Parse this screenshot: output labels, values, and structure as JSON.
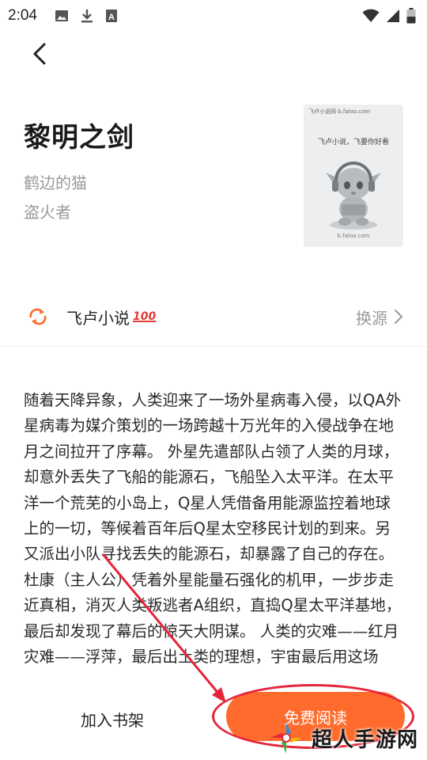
{
  "status_bar": {
    "time": "2:04",
    "icons_left": [
      "image-icon",
      "download-icon",
      "a-box-icon"
    ],
    "icons_right": [
      "wifi-icon",
      "signal-icon",
      "battery-icon"
    ]
  },
  "header": {
    "back_icon": "chevron-left-icon"
  },
  "book": {
    "title": "黎明之剑",
    "author": "鹤边的猫",
    "narrator": "盗火者",
    "cover": {
      "logo": "飞卢小说网 b.faloo.com",
      "tagline": "飞卢小说，飞要你好看",
      "url": "b.faloo.com"
    }
  },
  "source": {
    "icon": "refresh-arrows-icon",
    "name": "飞卢小说",
    "badge": "100",
    "switch_label": "换源",
    "switch_icon": "chevron-right-icon",
    "accent_color": "#ff6b2c"
  },
  "synopsis": "随着天降异象，人类迎来了一场外星病毒入侵，以QA外星病毒为媒介策划的一场跨越十万光年的入侵战争在地月之间拉开了序幕。 外星先遣部队占领了人类的月球，却意外丢失了飞船的能源石，飞船坠入太平洋。在太平洋一个荒芜的小岛上，Q星人凭借备用能源监控着地球上的一切，等候着百年后Q星太空移民计划的到来。另又派出小队寻找丢失的能源石，却暴露了自己的存在。杜康（主人公）凭着外星能量石强化的机甲，一步步走近真相，消灭人类叛逃者A组织，直捣Q星太平洋基地，最后却发现了幕后的惊天大阴谋。 人类的灾难——红月灾难——浮萍，最后出土类的理想，宇宙最后用这场",
  "bottom": {
    "add_shelf_label": "加入书架",
    "read_label": "免费阅读",
    "read_color": "#ff6b2c"
  },
  "annotation": {
    "color": "#e5253b"
  },
  "watermark": {
    "text": "超人手游网"
  }
}
